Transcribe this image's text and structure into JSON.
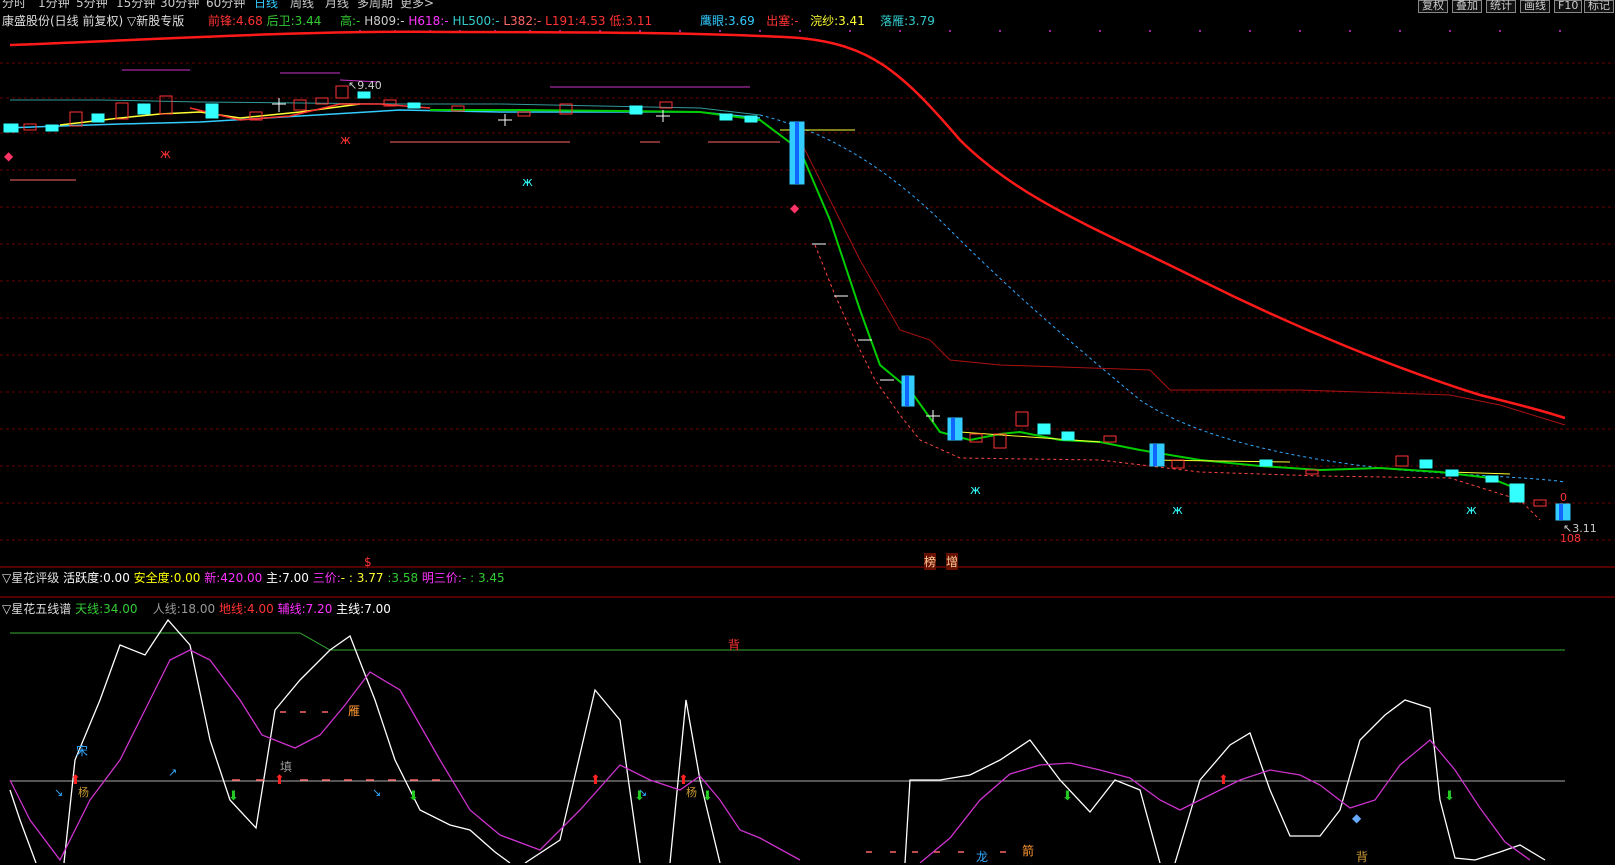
{
  "topbar": {
    "items": [
      "分时",
      "1分钟",
      "5分钟",
      "15分钟",
      "30分钟",
      "60分钟",
      "日线",
      "周线",
      "月线",
      "多周期",
      "更多>"
    ],
    "right_buttons": [
      "复权",
      "叠加",
      "统计",
      "画线",
      "F10",
      "标记"
    ]
  },
  "main_header": {
    "title": "康盛股份(日线 前复权)",
    "dropdown": "▽新股专版",
    "indicators": [
      {
        "label": "前锋:",
        "value": "4.68",
        "color": "#ff3333"
      },
      {
        "label": "后卫:",
        "value": "3.44",
        "color": "#33cc33"
      },
      {
        "label": "高:",
        "value": "-",
        "color": "#33cc33"
      },
      {
        "label": "H809:",
        "value": "-",
        "color": "#cccccc"
      },
      {
        "label": "H618:",
        "value": "-",
        "color": "#ff33ff"
      },
      {
        "label": "HL500:",
        "value": "-",
        "color": "#33cccc"
      },
      {
        "label": "L382:",
        "value": "-",
        "color": "#ff6666"
      },
      {
        "label": "L191:",
        "value": "4.53",
        "color": "#ff3333"
      },
      {
        "label": "低:",
        "value": "3.11",
        "color": "#ff3333"
      },
      {
        "label": "鹰眼:",
        "value": "3.69",
        "color": "#33ccff"
      },
      {
        "label": "出塞:",
        "value": "-",
        "color": "#ff3333"
      },
      {
        "label": "浣纱:",
        "value": "3.41",
        "color": "#ffff33"
      },
      {
        "label": "落雁:",
        "value": "3.79",
        "color": "#33cccc"
      }
    ]
  },
  "main_chart": {
    "price_high_label": "9.40",
    "price_low_label": "3.11",
    "zero_label": "0",
    "count_label": "108",
    "markers": [
      "$",
      "榜",
      "增"
    ]
  },
  "panel2": {
    "title": "▽星花评级",
    "items": [
      {
        "label": "活跃度:",
        "value": "0.00",
        "color": "#ffffff"
      },
      {
        "label": "安全度:",
        "value": "0.00",
        "color": "#ffff00"
      },
      {
        "label": "新:",
        "value": "420.00",
        "color": "#ff33ff"
      },
      {
        "label": "主:",
        "value": "7.00",
        "color": "#ffffff"
      },
      {
        "label": "三价:",
        "value": "- : 3.77",
        "color": "#ff33ff"
      },
      {
        "label": ":",
        "value": "3.58",
        "color": "#33cc33"
      },
      {
        "label": "明三价:",
        "value": "- : 3.45",
        "color": "#ff33ff"
      }
    ]
  },
  "panel3": {
    "title": "▽星花五线谱",
    "items": [
      {
        "label": "天线:",
        "value": "34.00",
        "color": "#33cc33"
      },
      {
        "label": "人线:",
        "value": "18.00",
        "color": "#999999"
      },
      {
        "label": "地线:",
        "value": "4.00",
        "color": "#ff3333"
      },
      {
        "label": "辅线:",
        "value": "7.20",
        "color": "#ff33ff"
      },
      {
        "label": "主线:",
        "value": "7.00",
        "color": "#ffffff"
      }
    ],
    "labels": [
      "背",
      "雁",
      "宋",
      "杨",
      "填",
      "杨",
      "龙",
      "箭",
      "背"
    ]
  }
}
